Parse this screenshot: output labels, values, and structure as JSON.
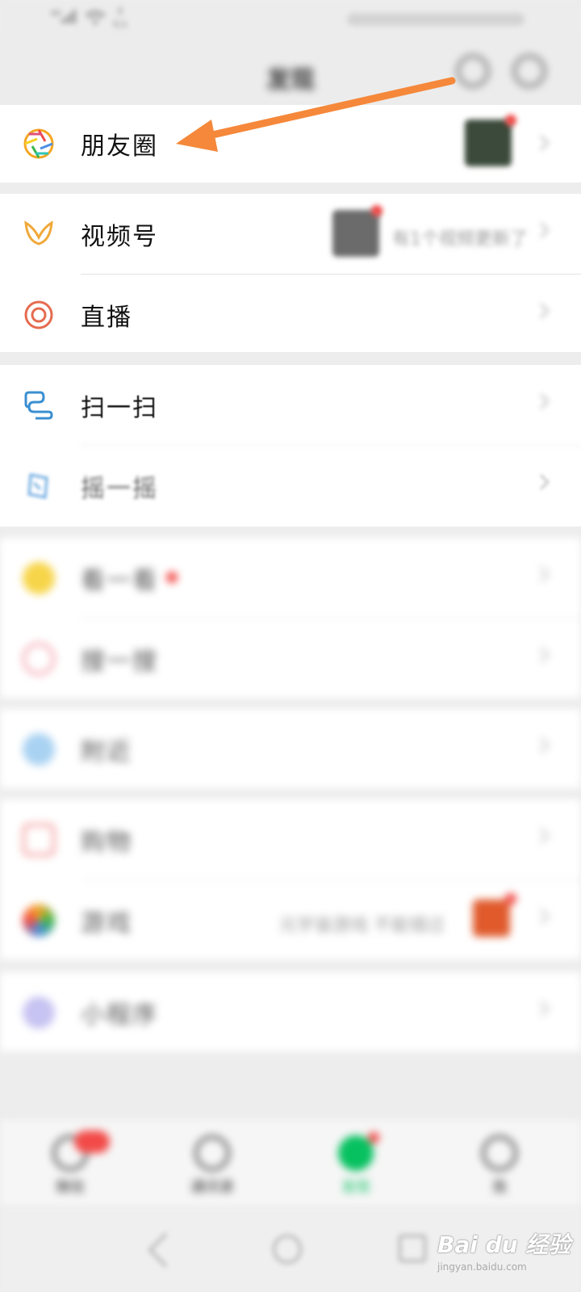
{
  "status_bar": {
    "network": "46",
    "speed_value": "8",
    "speed_unit": "K/s"
  },
  "header": {
    "title": "发现",
    "search_icon": "search-icon",
    "more_icon": "plus-circle-icon"
  },
  "groups": [
    {
      "items": [
        {
          "label": "朋友圈",
          "icon": "moments-aperture-icon",
          "has_thumbnail": true,
          "has_red_dot": true
        }
      ]
    },
    {
      "items": [
        {
          "label": "视频号",
          "icon": "channels-butterfly-icon",
          "trailing_text": "有1个视频更新了",
          "has_thumbnail": true,
          "has_red_dot": true
        },
        {
          "label": "直播",
          "icon": "live-ring-icon"
        }
      ]
    },
    {
      "items": [
        {
          "label": "扫一扫",
          "icon": "scan-icon"
        },
        {
          "label": "摇一摇",
          "icon": "shake-icon"
        }
      ]
    },
    {
      "items": [
        {
          "label": "看一看",
          "icon": "look-icon",
          "has_red_dot": true
        },
        {
          "label": "搜一搜",
          "icon": "search-star-icon"
        }
      ]
    },
    {
      "items": [
        {
          "label": "附近",
          "icon": "nearby-icon"
        }
      ]
    },
    {
      "items": [
        {
          "label": "购物",
          "icon": "shopping-bag-icon"
        },
        {
          "label": "游戏",
          "icon": "game-icon",
          "trailing_text": "元宇宙游戏 不能错过",
          "has_thumbnail": true,
          "has_red_dot": true
        }
      ]
    },
    {
      "items": [
        {
          "label": "小程序",
          "icon": "mini-program-icon"
        }
      ]
    }
  ],
  "tabbar": {
    "tabs": [
      {
        "label": "微信",
        "icon": "chat-icon",
        "has_badge": true
      },
      {
        "label": "通讯录",
        "icon": "contacts-icon"
      },
      {
        "label": "发现",
        "icon": "discover-icon",
        "active": true,
        "has_red_dot": true
      },
      {
        "label": "我",
        "icon": "me-icon"
      }
    ]
  },
  "annotation": {
    "arrow_color": "#f5883a",
    "points_to": "朋友圈"
  },
  "watermark": {
    "brand": "Bai du 经验",
    "sub": "jingyan.baidu.com"
  },
  "colors": {
    "accent_green": "#07c160",
    "badge_red": "#f24a48",
    "arrow_orange": "#f5883a"
  }
}
